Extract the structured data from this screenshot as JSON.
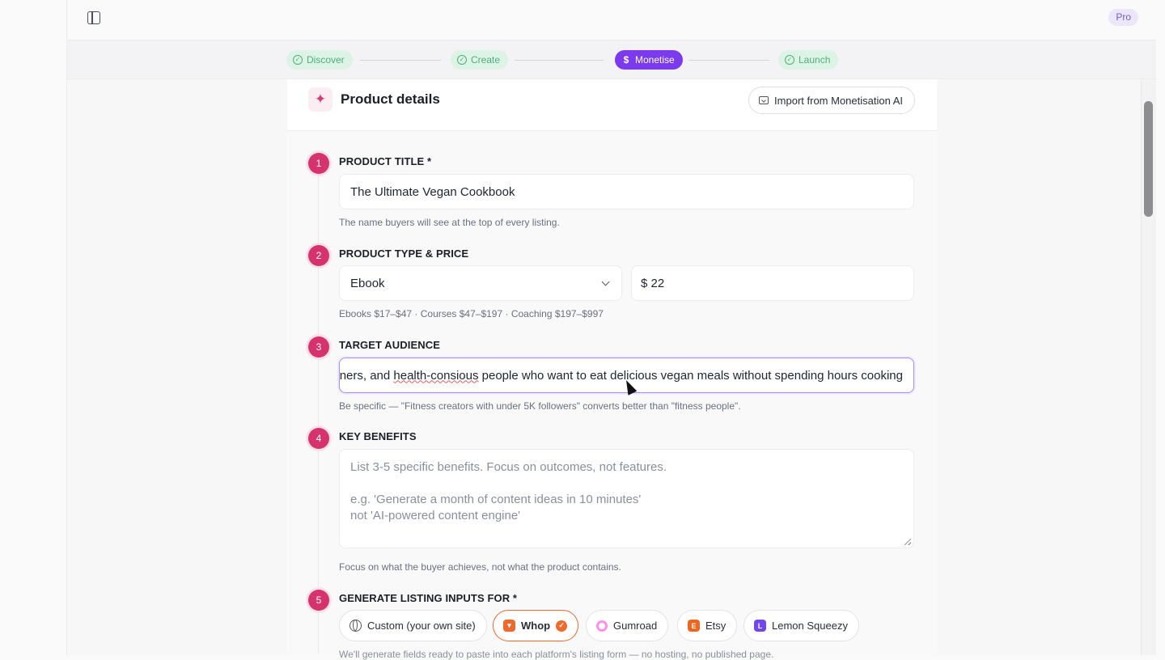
{
  "topbar": {
    "plan_badge": "Pro"
  },
  "stepper": [
    {
      "label": "Discover",
      "status": "done"
    },
    {
      "label": "Create",
      "status": "done"
    },
    {
      "label": "Monetise",
      "status": "active"
    },
    {
      "label": "Launch",
      "status": "done"
    }
  ],
  "card": {
    "title": "Product details",
    "import_button": "Import from Monetisation AI"
  },
  "sections": {
    "title": {
      "number": "1",
      "label": "PRODUCT TITLE *",
      "value": "The Ultimate Vegan Cookbook",
      "help": "The name buyers will see at the top of every listing."
    },
    "type_price": {
      "number": "2",
      "label": "PRODUCT TYPE & PRICE",
      "type_value": "Ebook",
      "price_value": "$ 22",
      "help": "Ebooks $17–$47 · Courses $47–$197 · Coaching $197–$997"
    },
    "audience": {
      "number": "3",
      "label": "TARGET AUDIENCE",
      "value_pre": "eginners, and ",
      "value_misspelled": "health-consious",
      "value_post": " people who want to eat delicious vegan meals without spending hours cooking",
      "help": "Be specific — \"Fitness creators with under 5K followers\" converts better than \"fitness people\"."
    },
    "benefits": {
      "number": "4",
      "label": "KEY BENEFITS",
      "placeholder_line1": "List 3-5 specific benefits. Focus on outcomes, not features.",
      "placeholder_line2": "e.g. 'Generate a month of content ideas in 10 minutes'",
      "placeholder_line3": "not 'AI-powered content engine'",
      "help": "Focus on what the buyer achieves, not what the product contains."
    },
    "platforms": {
      "number": "5",
      "label": "GENERATE LISTING INPUTS FOR *",
      "options": [
        {
          "label": "Custom (your own site)",
          "selected": false
        },
        {
          "label": "Whop",
          "selected": true,
          "color": "#f0682a"
        },
        {
          "label": "Gumroad",
          "selected": false,
          "color": "#ff90e8"
        },
        {
          "label": "Etsy",
          "selected": false,
          "color": "#f1641e"
        },
        {
          "label": "Lemon Squeezy",
          "selected": false,
          "color": "#7047eb"
        }
      ],
      "help": "We'll generate fields ready to paste into each platform's listing form — no hosting, no published page."
    }
  },
  "colors": {
    "accent": "#7c3aed",
    "step_number": "#d6336c",
    "done_green": "#4fae7c",
    "whop_orange": "#f0682a"
  }
}
